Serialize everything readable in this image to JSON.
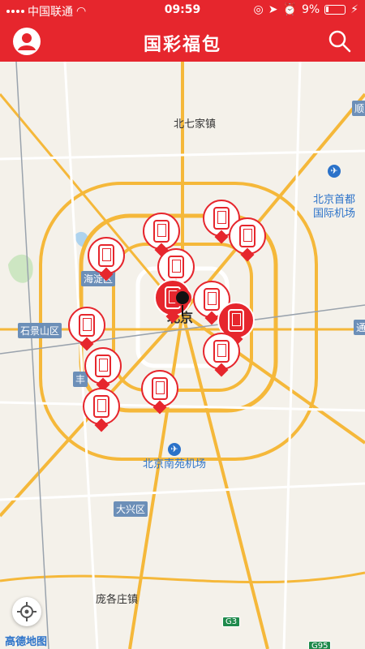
{
  "status_bar": {
    "carrier": "中国联通",
    "time": "09:59",
    "battery": "9%"
  },
  "header": {
    "title": "国彩福包",
    "left_icon": "user-avatar-icon",
    "right_icon": "search-icon"
  },
  "map": {
    "places": {
      "beiqijia": "北七家镇",
      "beijing": "北京",
      "pangezhuang": "庞各庄镇",
      "capital_airport": "北京首都\n国际机场",
      "nanyuan_airport": "北京南苑机场",
      "haidian": "海淀区",
      "shijingshan": "石景山区",
      "daxing": "大兴区",
      "shun": "顺",
      "tong": "通",
      "feng": "丰",
      "g3": "G3",
      "g95": "G95"
    },
    "attribution": "高德地图"
  },
  "colors": {
    "brand": "#e6262d",
    "map_bg": "#f4f1ea",
    "road_major": "#f5b83a",
    "road_minor": "#ffffff",
    "district_label": "#6c8fb8",
    "airport": "#2b72c9"
  }
}
